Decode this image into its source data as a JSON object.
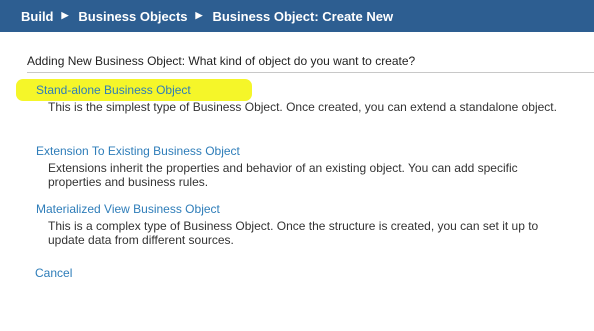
{
  "breadcrumb": {
    "items": [
      "Build",
      "Business Objects"
    ],
    "current": "Business Object: Create New",
    "separator": "▶"
  },
  "question": "Adding New Business Object: What kind of object do you want to create?",
  "options": [
    {
      "label": "Stand-alone Business Object",
      "description": "This is the simplest type of Business Object. Once created, you can extend a standalone object.",
      "highlighted": true
    },
    {
      "label": "Extension To Existing Business Object",
      "description": "Extensions inherit the properties and behavior of an existing object. You can add specific properties and business rules."
    },
    {
      "label": "Materialized View Business Object",
      "description": "This is a complex type of Business Object. Once the structure is created, you can set it up to update data from different sources."
    }
  ],
  "cancel_label": "Cancel",
  "colors": {
    "header_bg": "#2d5e91",
    "link": "#2e7db9",
    "highlight": "#f4f51e"
  }
}
